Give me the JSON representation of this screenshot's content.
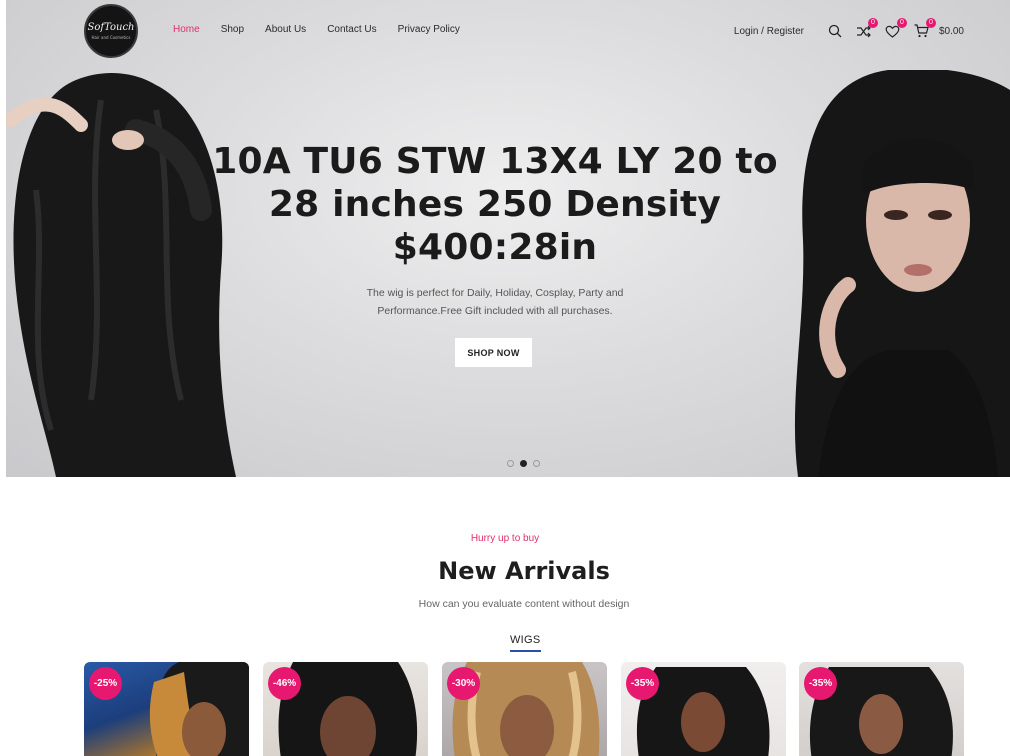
{
  "brand": {
    "logo_text": "SofTouch",
    "logo_sub": "Hair and Cosmetics"
  },
  "nav": {
    "items": [
      {
        "label": "Home",
        "active": true
      },
      {
        "label": "Shop",
        "active": false
      },
      {
        "label": "About Us",
        "active": false
      },
      {
        "label": "Contact Us",
        "active": false
      },
      {
        "label": "Privacy Policy",
        "active": false
      }
    ]
  },
  "header": {
    "login_label": "Login / Register",
    "compare_count": "0",
    "wishlist_count": "0",
    "cart_count": "0",
    "cart_total": "$0.00",
    "icons": [
      "search-icon",
      "compare-icon",
      "heart-icon",
      "cart-icon"
    ]
  },
  "hero": {
    "title_line1": "10A TU6 STW 13X4 LY 20 to",
    "title_line2": "28 inches 250 Density",
    "title_line3": "$400:28in",
    "subtitle_line1": "The wig is perfect for Daily, Holiday, Cosplay, Party and",
    "subtitle_line2": "Performance.Free Gift included with all purchases.",
    "cta_label": "SHOP NOW",
    "slides": 3,
    "active_slide": 2
  },
  "section": {
    "kicker": "Hurry up to buy",
    "title": "New Arrivals",
    "subtitle": "How can you evaluate content without design",
    "tab": "WIGS"
  },
  "products": [
    {
      "discount": "-25%"
    },
    {
      "discount": "-46%"
    },
    {
      "discount": "-30%"
    },
    {
      "discount": "-35%"
    },
    {
      "discount": "-35%"
    }
  ],
  "colors": {
    "accent": "#e1306c",
    "badge": "#e6186f",
    "tab_underline": "#2b4ea8"
  }
}
